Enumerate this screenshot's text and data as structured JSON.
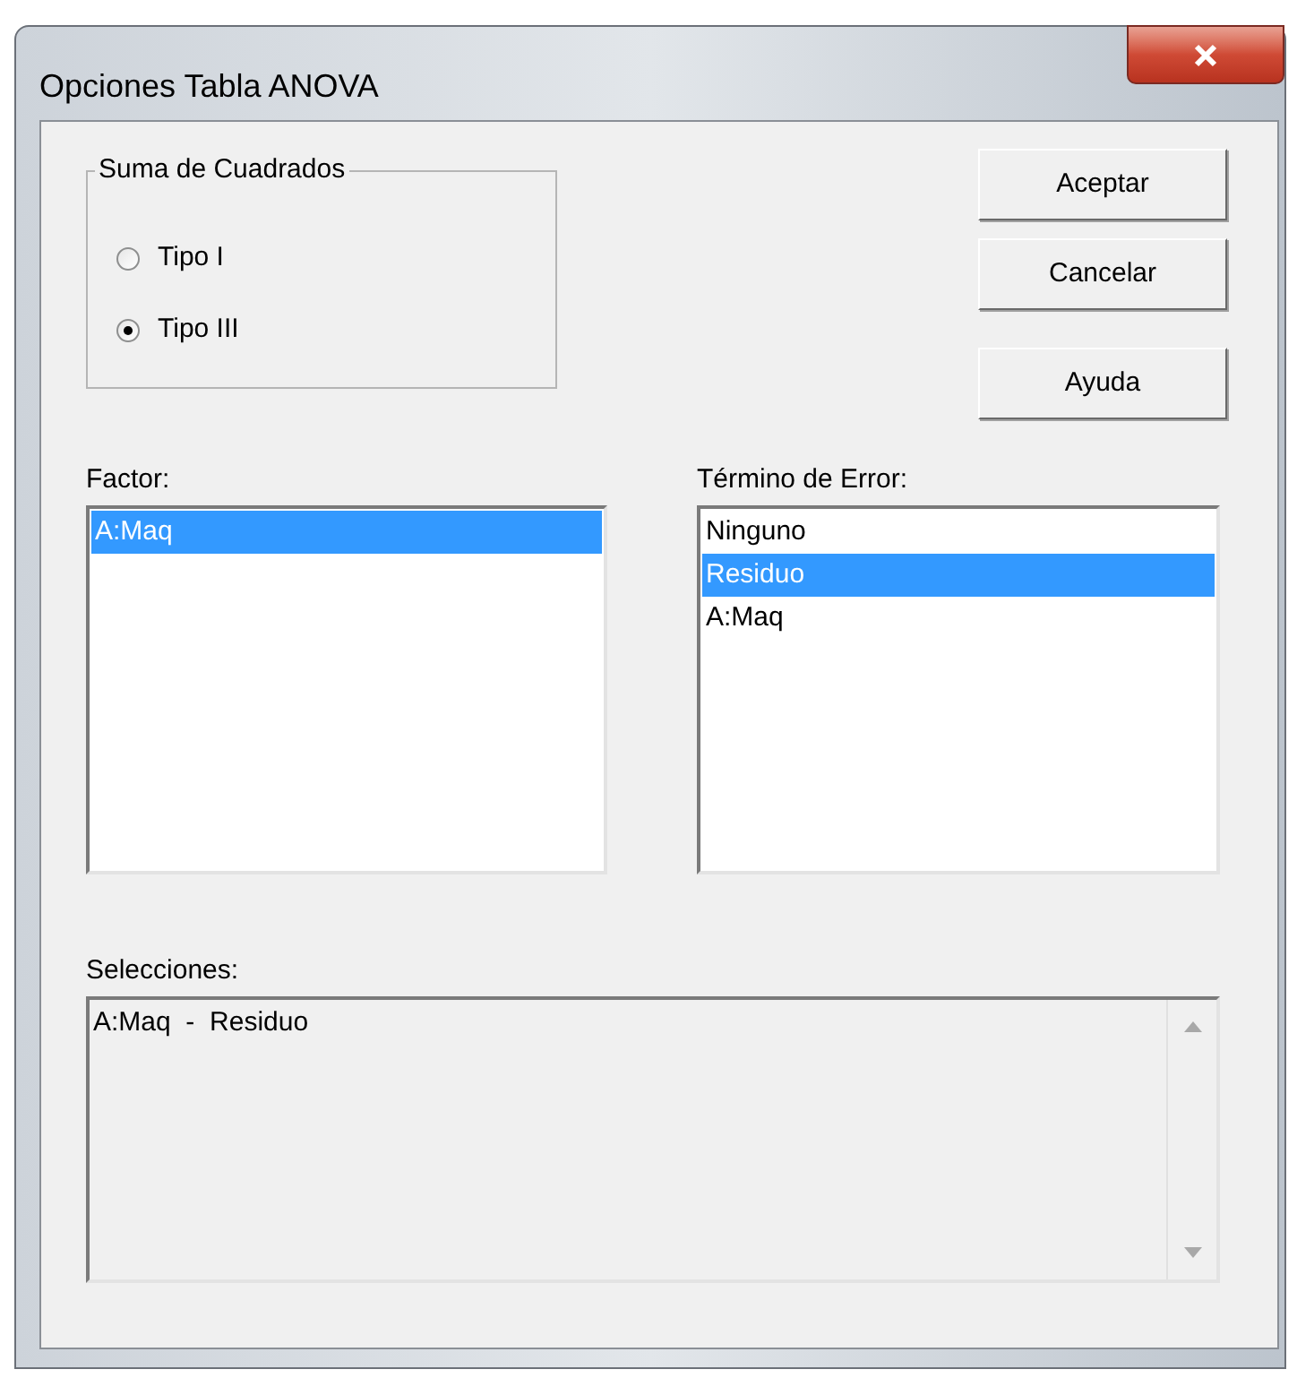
{
  "window": {
    "title": "Opciones Tabla ANOVA"
  },
  "sum_of_squares": {
    "label": "Suma de Cuadrados",
    "options": [
      {
        "label": "Tipo I",
        "selected": false
      },
      {
        "label": "Tipo III",
        "selected": true
      }
    ]
  },
  "buttons": [
    "Aceptar",
    "Cancelar",
    "Ayuda"
  ],
  "factor": {
    "label": "Factor:",
    "items": [
      {
        "text": "A:Maq",
        "selected": true
      }
    ]
  },
  "error_term": {
    "label": "Término de Error:",
    "items": [
      {
        "text": "Ninguno",
        "selected": false
      },
      {
        "text": "Residuo",
        "selected": true
      },
      {
        "text": "A:Maq",
        "selected": false
      }
    ]
  },
  "selections": {
    "label": "Selecciones:",
    "lines": [
      "A:Maq  -  Residuo"
    ]
  }
}
